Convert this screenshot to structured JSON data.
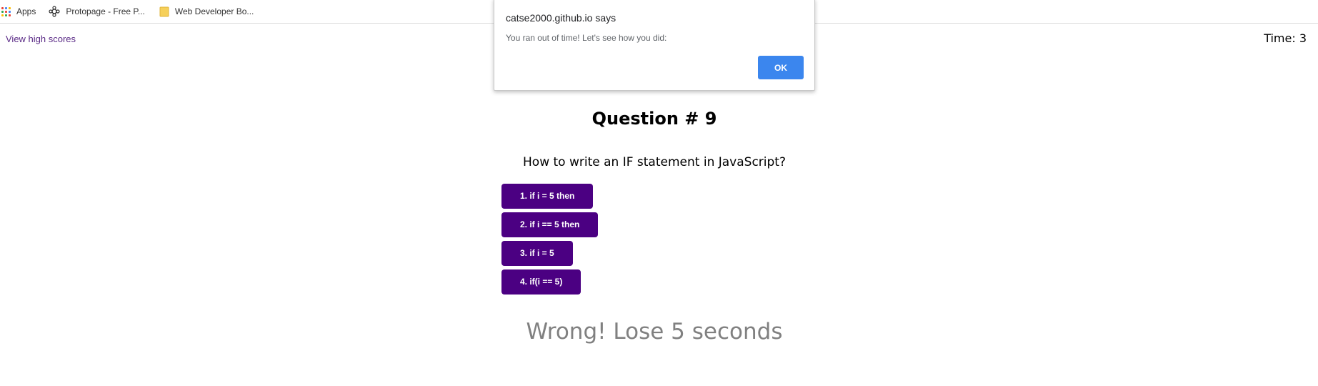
{
  "bookmarks": {
    "items": [
      {
        "label": "Apps",
        "icon": "apps-grid-icon"
      },
      {
        "label": "Protopage - Free P...",
        "icon": "protopage-icon"
      },
      {
        "label": "Web Developer Bo...",
        "icon": "folder-icon"
      }
    ]
  },
  "header": {
    "high_scores_link": "View high scores",
    "timer": "Time: 3"
  },
  "quiz": {
    "question_title": "Question # 9",
    "question_text": "How to write an IF statement in JavaScript?",
    "answers": [
      "1. if i = 5 then",
      "2. if i == 5 then",
      "3. if i = 5",
      "4. if(i == 5)"
    ],
    "feedback": "Wrong! Lose 5 seconds"
  },
  "alert": {
    "title": "catse2000.github.io says",
    "message": "You ran out of time! Let's see how you did:",
    "ok_label": "OK"
  },
  "colors": {
    "answer_button": "#4b0082",
    "link": "#5a2a86",
    "feedback": "#808080",
    "dialog_button": "#3b86ee"
  }
}
